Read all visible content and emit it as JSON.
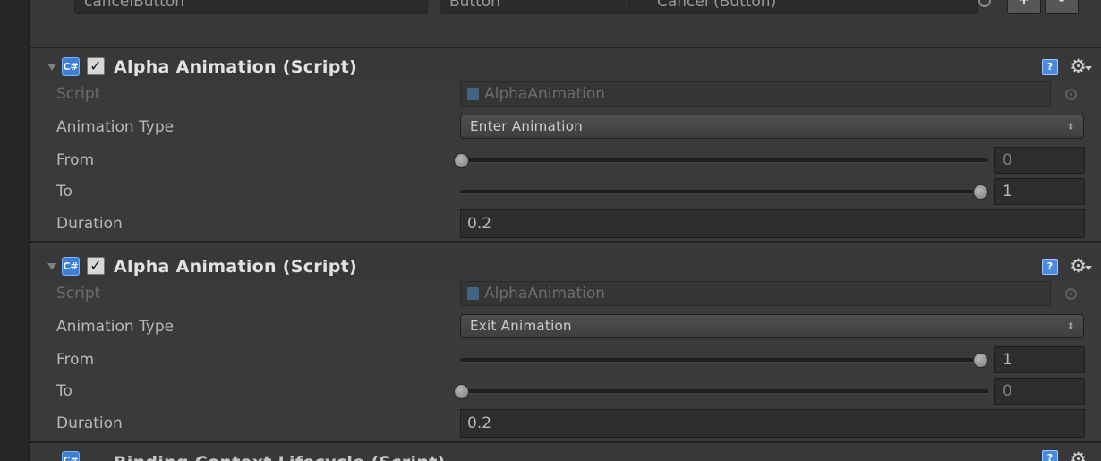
{
  "top_row": {
    "field_name": "cancelButton",
    "type_value": "Button",
    "object_value": "Cancel (Button)"
  },
  "components": [
    {
      "title": "Alpha Animation (Script)",
      "script_label": "Script",
      "script_value": "AlphaAnimation",
      "animation_type_label": "Animation Type",
      "animation_type_value": "Enter Animation",
      "from_label": "From",
      "from_value": "0",
      "to_label": "To",
      "to_value": "1",
      "duration_label": "Duration",
      "duration_value": "0.2"
    },
    {
      "title": "Alpha Animation (Script)",
      "script_label": "Script",
      "script_value": "AlphaAnimation",
      "animation_type_label": "Animation Type",
      "animation_type_value": "Exit Animation",
      "from_label": "From",
      "from_value": "1",
      "to_label": "To",
      "to_value": "0",
      "duration_label": "Duration",
      "duration_value": "0.2"
    }
  ],
  "bottom_component": {
    "title": "Binding Context Lifecycle (Script)"
  },
  "icons": {
    "cs_script": "csharp-script-icon",
    "help": "help-icon",
    "gear": "gear-icon",
    "foldout": "foldout-arrow-icon",
    "object_picker": "object-picker-icon"
  },
  "colors": {
    "panel": "#3a3a3a",
    "field": "#2d2d2d",
    "accent": "#3d7fd4"
  }
}
